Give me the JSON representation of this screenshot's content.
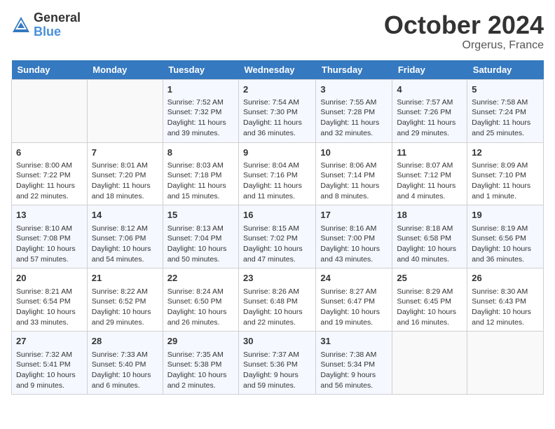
{
  "header": {
    "logo_general": "General",
    "logo_blue": "Blue",
    "month_title": "October 2024",
    "location": "Orgerus, France"
  },
  "weekdays": [
    "Sunday",
    "Monday",
    "Tuesday",
    "Wednesday",
    "Thursday",
    "Friday",
    "Saturday"
  ],
  "weeks": [
    [
      {
        "day": "",
        "sunrise": "",
        "sunset": "",
        "daylight": ""
      },
      {
        "day": "",
        "sunrise": "",
        "sunset": "",
        "daylight": ""
      },
      {
        "day": "1",
        "sunrise": "Sunrise: 7:52 AM",
        "sunset": "Sunset: 7:32 PM",
        "daylight": "Daylight: 11 hours and 39 minutes."
      },
      {
        "day": "2",
        "sunrise": "Sunrise: 7:54 AM",
        "sunset": "Sunset: 7:30 PM",
        "daylight": "Daylight: 11 hours and 36 minutes."
      },
      {
        "day": "3",
        "sunrise": "Sunrise: 7:55 AM",
        "sunset": "Sunset: 7:28 PM",
        "daylight": "Daylight: 11 hours and 32 minutes."
      },
      {
        "day": "4",
        "sunrise": "Sunrise: 7:57 AM",
        "sunset": "Sunset: 7:26 PM",
        "daylight": "Daylight: 11 hours and 29 minutes."
      },
      {
        "day": "5",
        "sunrise": "Sunrise: 7:58 AM",
        "sunset": "Sunset: 7:24 PM",
        "daylight": "Daylight: 11 hours and 25 minutes."
      }
    ],
    [
      {
        "day": "6",
        "sunrise": "Sunrise: 8:00 AM",
        "sunset": "Sunset: 7:22 PM",
        "daylight": "Daylight: 11 hours and 22 minutes."
      },
      {
        "day": "7",
        "sunrise": "Sunrise: 8:01 AM",
        "sunset": "Sunset: 7:20 PM",
        "daylight": "Daylight: 11 hours and 18 minutes."
      },
      {
        "day": "8",
        "sunrise": "Sunrise: 8:03 AM",
        "sunset": "Sunset: 7:18 PM",
        "daylight": "Daylight: 11 hours and 15 minutes."
      },
      {
        "day": "9",
        "sunrise": "Sunrise: 8:04 AM",
        "sunset": "Sunset: 7:16 PM",
        "daylight": "Daylight: 11 hours and 11 minutes."
      },
      {
        "day": "10",
        "sunrise": "Sunrise: 8:06 AM",
        "sunset": "Sunset: 7:14 PM",
        "daylight": "Daylight: 11 hours and 8 minutes."
      },
      {
        "day": "11",
        "sunrise": "Sunrise: 8:07 AM",
        "sunset": "Sunset: 7:12 PM",
        "daylight": "Daylight: 11 hours and 4 minutes."
      },
      {
        "day": "12",
        "sunrise": "Sunrise: 8:09 AM",
        "sunset": "Sunset: 7:10 PM",
        "daylight": "Daylight: 11 hours and 1 minute."
      }
    ],
    [
      {
        "day": "13",
        "sunrise": "Sunrise: 8:10 AM",
        "sunset": "Sunset: 7:08 PM",
        "daylight": "Daylight: 10 hours and 57 minutes."
      },
      {
        "day": "14",
        "sunrise": "Sunrise: 8:12 AM",
        "sunset": "Sunset: 7:06 PM",
        "daylight": "Daylight: 10 hours and 54 minutes."
      },
      {
        "day": "15",
        "sunrise": "Sunrise: 8:13 AM",
        "sunset": "Sunset: 7:04 PM",
        "daylight": "Daylight: 10 hours and 50 minutes."
      },
      {
        "day": "16",
        "sunrise": "Sunrise: 8:15 AM",
        "sunset": "Sunset: 7:02 PM",
        "daylight": "Daylight: 10 hours and 47 minutes."
      },
      {
        "day": "17",
        "sunrise": "Sunrise: 8:16 AM",
        "sunset": "Sunset: 7:00 PM",
        "daylight": "Daylight: 10 hours and 43 minutes."
      },
      {
        "day": "18",
        "sunrise": "Sunrise: 8:18 AM",
        "sunset": "Sunset: 6:58 PM",
        "daylight": "Daylight: 10 hours and 40 minutes."
      },
      {
        "day": "19",
        "sunrise": "Sunrise: 8:19 AM",
        "sunset": "Sunset: 6:56 PM",
        "daylight": "Daylight: 10 hours and 36 minutes."
      }
    ],
    [
      {
        "day": "20",
        "sunrise": "Sunrise: 8:21 AM",
        "sunset": "Sunset: 6:54 PM",
        "daylight": "Daylight: 10 hours and 33 minutes."
      },
      {
        "day": "21",
        "sunrise": "Sunrise: 8:22 AM",
        "sunset": "Sunset: 6:52 PM",
        "daylight": "Daylight: 10 hours and 29 minutes."
      },
      {
        "day": "22",
        "sunrise": "Sunrise: 8:24 AM",
        "sunset": "Sunset: 6:50 PM",
        "daylight": "Daylight: 10 hours and 26 minutes."
      },
      {
        "day": "23",
        "sunrise": "Sunrise: 8:26 AM",
        "sunset": "Sunset: 6:48 PM",
        "daylight": "Daylight: 10 hours and 22 minutes."
      },
      {
        "day": "24",
        "sunrise": "Sunrise: 8:27 AM",
        "sunset": "Sunset: 6:47 PM",
        "daylight": "Daylight: 10 hours and 19 minutes."
      },
      {
        "day": "25",
        "sunrise": "Sunrise: 8:29 AM",
        "sunset": "Sunset: 6:45 PM",
        "daylight": "Daylight: 10 hours and 16 minutes."
      },
      {
        "day": "26",
        "sunrise": "Sunrise: 8:30 AM",
        "sunset": "Sunset: 6:43 PM",
        "daylight": "Daylight: 10 hours and 12 minutes."
      }
    ],
    [
      {
        "day": "27",
        "sunrise": "Sunrise: 7:32 AM",
        "sunset": "Sunset: 5:41 PM",
        "daylight": "Daylight: 10 hours and 9 minutes."
      },
      {
        "day": "28",
        "sunrise": "Sunrise: 7:33 AM",
        "sunset": "Sunset: 5:40 PM",
        "daylight": "Daylight: 10 hours and 6 minutes."
      },
      {
        "day": "29",
        "sunrise": "Sunrise: 7:35 AM",
        "sunset": "Sunset: 5:38 PM",
        "daylight": "Daylight: 10 hours and 2 minutes."
      },
      {
        "day": "30",
        "sunrise": "Sunrise: 7:37 AM",
        "sunset": "Sunset: 5:36 PM",
        "daylight": "Daylight: 9 hours and 59 minutes."
      },
      {
        "day": "31",
        "sunrise": "Sunrise: 7:38 AM",
        "sunset": "Sunset: 5:34 PM",
        "daylight": "Daylight: 9 hours and 56 minutes."
      },
      {
        "day": "",
        "sunrise": "",
        "sunset": "",
        "daylight": ""
      },
      {
        "day": "",
        "sunrise": "",
        "sunset": "",
        "daylight": ""
      }
    ]
  ]
}
